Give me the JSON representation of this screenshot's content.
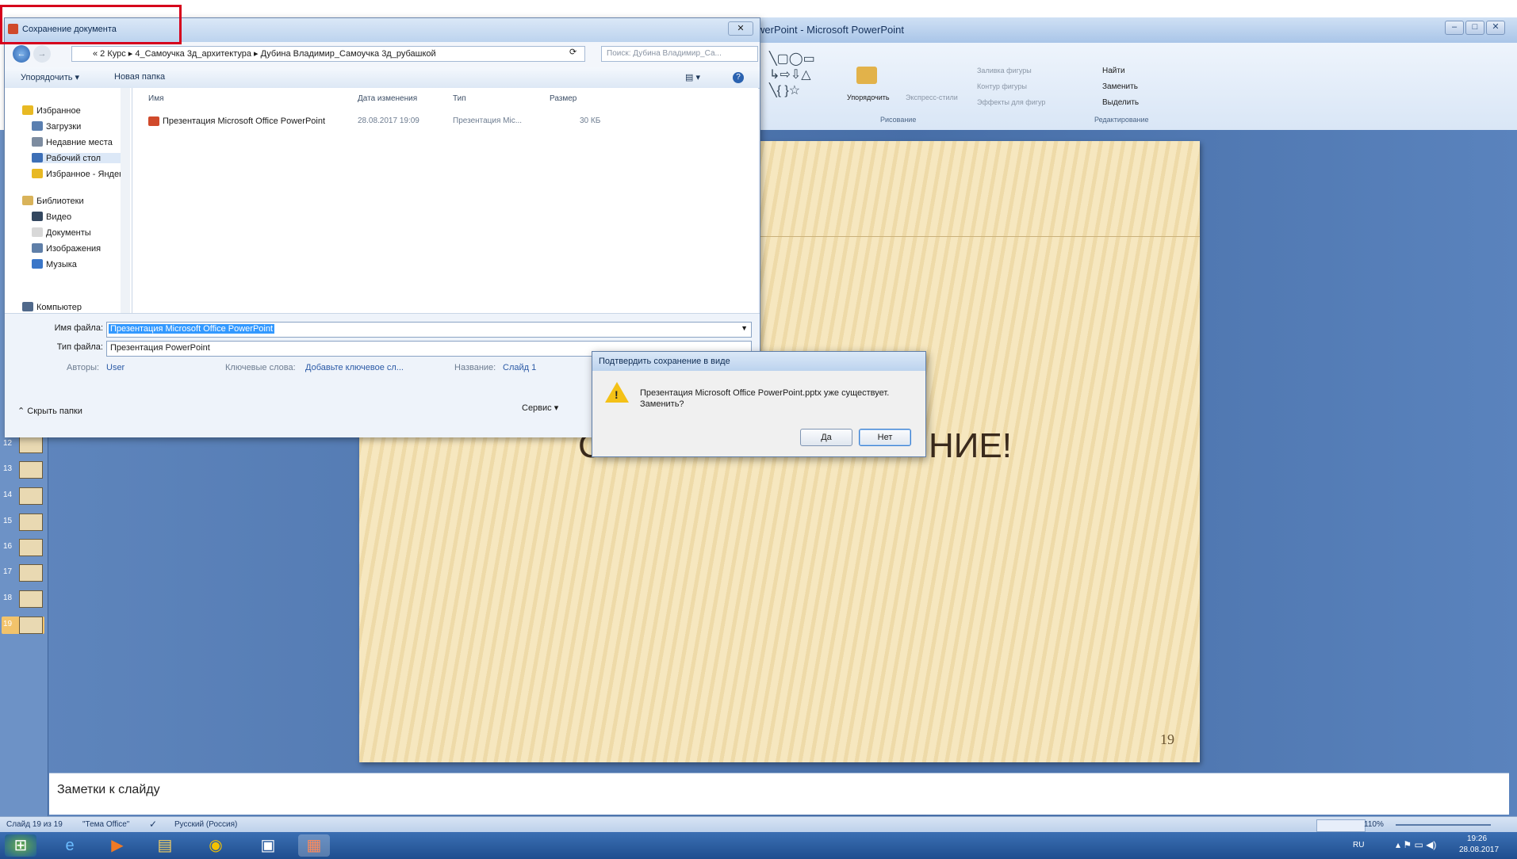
{
  "powerpoint": {
    "title": "werPoint - Microsoft PowerPoint",
    "ribbon": {
      "arrange": "Упорядочить",
      "quick_styles": "Экспресс-стили",
      "fill": "Заливка фигуры",
      "outline": "Контур фигуры",
      "effects": "Эффекты для фигур",
      "group_drawing": "Рисование",
      "find": "Найти",
      "replace": "Заменить",
      "select": "Выделить",
      "group_editing": "Редактирование"
    },
    "thumbnails": [
      "12",
      "13",
      "14",
      "15",
      "16",
      "17",
      "18",
      "19"
    ],
    "slide": {
      "heading": "НИЕ!",
      "heading_partial": "С",
      "number": "19"
    },
    "notes_label": "Заметки к слайду",
    "status": {
      "slide": "Слайд 19 из 19",
      "theme": "\"Тема Office\"",
      "language": "Русский (Россия)",
      "zoom": "110%"
    }
  },
  "taskbar": {
    "lang": "RU",
    "time": "19:26",
    "date": "28.08.2017"
  },
  "save_dialog": {
    "title": "Сохранение документа",
    "breadcrumb": "« 2 Курс ▸ 4_Самоучка 3д_архитектура ▸ Дубина Владимир_Самоучка 3д_рубашкой",
    "search_placeholder": "Поиск: Дубина Владимир_Са...",
    "organize": "Упорядочить ▾",
    "new_folder": "Новая папка",
    "nav": [
      {
        "label": "Избранное",
        "color": "#e8b923"
      },
      {
        "label": "Загрузки",
        "color": "#5a7fb0"
      },
      {
        "label": "Недавние места",
        "color": "#7d8ca0"
      },
      {
        "label": "Рабочий стол",
        "color": "#3d6fb6"
      },
      {
        "label": "Избранное - Яндекс",
        "color": "#e8b923"
      },
      {
        "label": "Библиотеки",
        "color": "#d9b35a"
      },
      {
        "label": "Видео",
        "color": "#33475f"
      },
      {
        "label": "Документы",
        "color": "#d8d8d8"
      },
      {
        "label": "Изображения",
        "color": "#5f7fa8"
      },
      {
        "label": "Музыка",
        "color": "#3a76c8"
      },
      {
        "label": "Компьютер",
        "color": "#50698b"
      }
    ],
    "columns": {
      "name": "Имя",
      "date": "Дата изменения",
      "type": "Тип",
      "size": "Размер"
    },
    "file": {
      "name": "Презентация Microsoft Office PowerPoint",
      "date": "28.08.2017 19:09",
      "type": "Презентация Mic...",
      "size": "30 КБ"
    },
    "filename_label": "Имя файла:",
    "filename_value": "Презентация Microsoft Office PowerPoint",
    "filetype_label": "Тип файла:",
    "filetype_value": "Презентация PowerPoint",
    "authors_label": "Авторы:",
    "authors_value": "User",
    "keywords_label": "Ключевые слова:",
    "keywords_value": "Добавьте ключевое сл...",
    "title_label": "Название:",
    "title_value": "Слайд 1",
    "hide_folders": "Скрыть папки",
    "service": "Сервис"
  },
  "confirm_dialog": {
    "title": "Подтвердить сохранение в виде",
    "message": "Презентация Microsoft Office PowerPoint.pptx уже существует. Заменить?",
    "yes": "Да",
    "no": "Нет"
  }
}
